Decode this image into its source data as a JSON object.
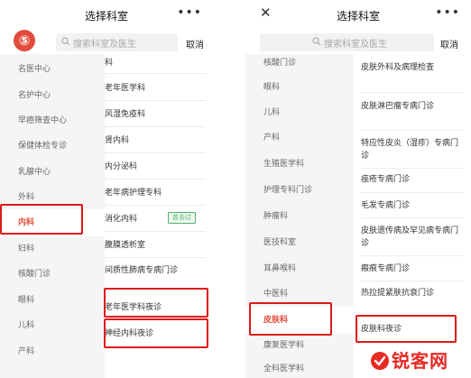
{
  "left_screen": {
    "title": "选择科室",
    "more_icon": "more-icon",
    "step_number": "⑤",
    "search": {
      "placeholder": "搜索科室及医生",
      "cancel_label": "取消"
    },
    "categories": [
      "名医中心",
      "名护中心",
      "早癌筛查中心",
      "保健体检专诊",
      "乳腺中心",
      "外科",
      "内科",
      "妇科",
      "核酸门诊",
      "眼科",
      "儿科",
      "产科"
    ],
    "active_category": "内科",
    "departments": [
      "科",
      "老年医学科",
      "风湿免疫科",
      "肾内科",
      "内分泌科",
      "老年病护理专科",
      "消化内科",
      "腹膜透析室",
      "间质性肺病专病门诊",
      "老年医学科夜诊",
      "神经内科夜诊"
    ],
    "visited_badge": "曾去过"
  },
  "right_screen": {
    "title": "选择科室",
    "close_icon": "close-icon",
    "more_icon": "more-icon",
    "search": {
      "placeholder": "搜索科室及医生",
      "cancel_label": "取消"
    },
    "categories": [
      "核酸门诊",
      "眼科",
      "儿科",
      "产科",
      "生殖医学科",
      "护理专科门诊",
      "肿瘤科",
      "医技科室",
      "耳鼻喉科",
      "中医科",
      "皮肤科",
      "康复医学科",
      "全科医学科"
    ],
    "active_category": "皮肤科",
    "departments": [
      "皮肤外科及病理检查",
      "皮肤淋巴瘤专病门诊",
      "特应性皮炎（湿疹）专病门诊",
      "痤疮专病门诊",
      "毛发专病门诊",
      "皮肤遗传病及罕见病专病门诊",
      "瘢痕专病门诊",
      "热拉提紧肤抗衰门诊",
      "皮肤科夜诊"
    ]
  },
  "watermark": {
    "text": "锐客网"
  },
  "colors": {
    "accent_red": "#e24c3c",
    "highlight_box": "#e01818",
    "badge_green": "#4fb36b"
  }
}
